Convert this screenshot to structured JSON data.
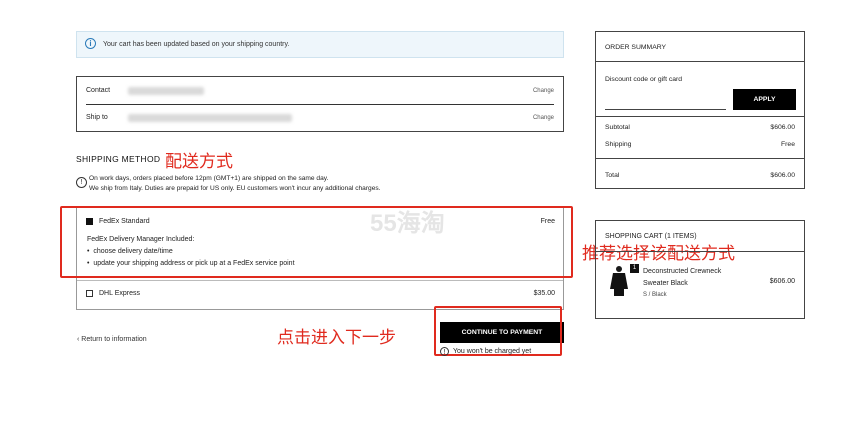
{
  "notice": {
    "text": "Your cart has been updated based on your shipping country."
  },
  "contact": {
    "contact_label": "Contact",
    "contact_change": "Change",
    "ship_label": "Ship to",
    "ship_change": "Change"
  },
  "shipping": {
    "title": "SHIPPING METHOD",
    "info_line1": "On work days, orders placed before 12pm (GMT+1) are shipped on the same day.",
    "info_line2": "We ship from Italy. Duties are prepaid for US only. EU customers won't incur any additional charges.",
    "options": [
      {
        "name": "FedEx Standard",
        "price": "Free",
        "selected": true,
        "details_title": "FedEx Delivery Manager Included:",
        "details": [
          "choose delivery date/time",
          "update your shipping address or pick up at a FedEx service point"
        ]
      },
      {
        "name": "DHL Express",
        "price": "$35.00",
        "selected": false
      }
    ]
  },
  "nav": {
    "return_label": "Return to information",
    "continue_label": "CONTINUE TO PAYMENT",
    "charge_note": "You won't be charged yet"
  },
  "order_summary": {
    "title": "ORDER SUMMARY",
    "discount_label": "Discount code or gift card",
    "apply_label": "APPLY",
    "subtotal_label": "Subtotal",
    "subtotal_value": "$606.00",
    "shipping_label": "Shipping",
    "shipping_value": "Free",
    "total_label": "Total",
    "total_value": "$606.00"
  },
  "cart": {
    "title": "SHOPPING CART (1 ITEMS)",
    "item": {
      "qty": "1",
      "name_line1": "Deconstructed Crewneck",
      "name_line2": "Sweater Black",
      "variant": "S / Black",
      "price": "$606.00"
    }
  },
  "annotations": {
    "shipping_method": "配送方式",
    "recommend": "推荐选择该配送方式",
    "next_step": "点击进入下一步",
    "watermark": "55海淘"
  },
  "colors": {
    "annotation_red": "#e02a1e",
    "notice_bg": "#eef6fb",
    "notice_icon": "#2b7bb9"
  }
}
